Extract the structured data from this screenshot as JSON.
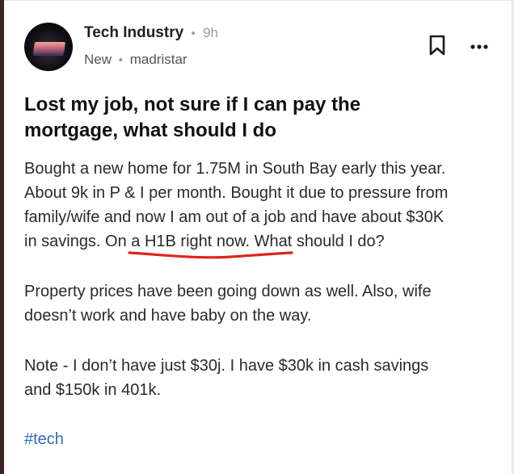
{
  "post": {
    "author": "Tech Industry",
    "separator": "•",
    "time": "9h",
    "status": "New",
    "meta_separator": "•",
    "username": "madristar",
    "title_line1": "Lost my job, not sure if I can pay the",
    "title_line2": "mortgage, what should I do",
    "para1_line1": "Bought a new home for 1.75M in South Bay early this year.",
    "para1_line2": "About 9k in P & I per month. Bought it due to pressure from",
    "para1_line3": "family/wife and now I am out of a job and have about $30K",
    "para1_line4": "in savings. On a H1B right now. What should I do?",
    "para2_line1": "Property prices have been going down as well. Also, wife",
    "para2_line2": "doesn’t work and have baby on the way.",
    "para3_line1": "Note - I don’t have just $30j. I have $30k in cash savings",
    "para3_line2": "and $150k in 401k.",
    "hashtag": "#tech"
  },
  "icons": {
    "bookmark": "bookmark-icon",
    "more": "more-options-icon",
    "avatar": "laptop-avatar"
  },
  "colors": {
    "hashtag": "#2f6db5",
    "annotation_underline": "#e0241b"
  }
}
